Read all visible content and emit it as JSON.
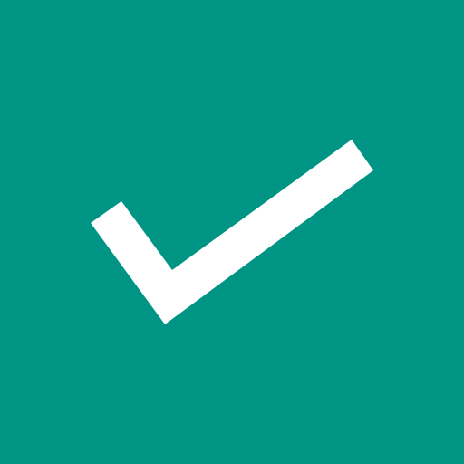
{
  "tile": {
    "background_color": "#009485",
    "icon": {
      "name": "check-icon",
      "color": "#FFFFFF"
    }
  }
}
